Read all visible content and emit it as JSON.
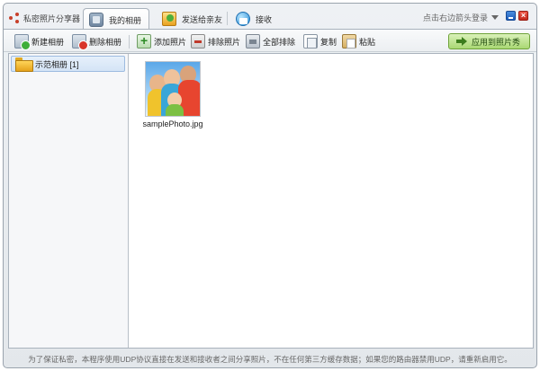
{
  "app": {
    "title": "私密照片分享器"
  },
  "tabs": [
    {
      "label": "我的相册",
      "icon": "album-icon",
      "active": true
    },
    {
      "label": "发送给亲友",
      "icon": "send-icon",
      "active": false
    },
    {
      "label": "接收",
      "icon": "receive-icon",
      "active": false
    }
  ],
  "header": {
    "login_hint": "点击右边箭头登录"
  },
  "toolbar": {
    "new_album": "新建相册",
    "delete_album": "删除相册",
    "add_photo": "添加照片",
    "remove_photo": "排除照片",
    "remove_all": "全部排除",
    "copy": "复制",
    "paste": "粘贴",
    "apply": "应用到照片秀"
  },
  "sidebar": {
    "albums": [
      {
        "label": "示范相册 [1]",
        "icon": "folder-icon",
        "selected": true
      }
    ]
  },
  "photos": [
    {
      "filename": "samplePhoto.jpg"
    }
  ],
  "footer": {
    "notice": "为了保证私密，本程序使用UDP协议直接在发送和接收者之间分享照片，不在任何第三方缓存数据；如果您的路由器禁用UDP，请重新启用它。"
  },
  "colors": {
    "accent_green": "#a9d874",
    "selection_blue": "#d4e4f6",
    "close_red": "#c42a1c",
    "minimize_blue": "#1e5db8"
  }
}
